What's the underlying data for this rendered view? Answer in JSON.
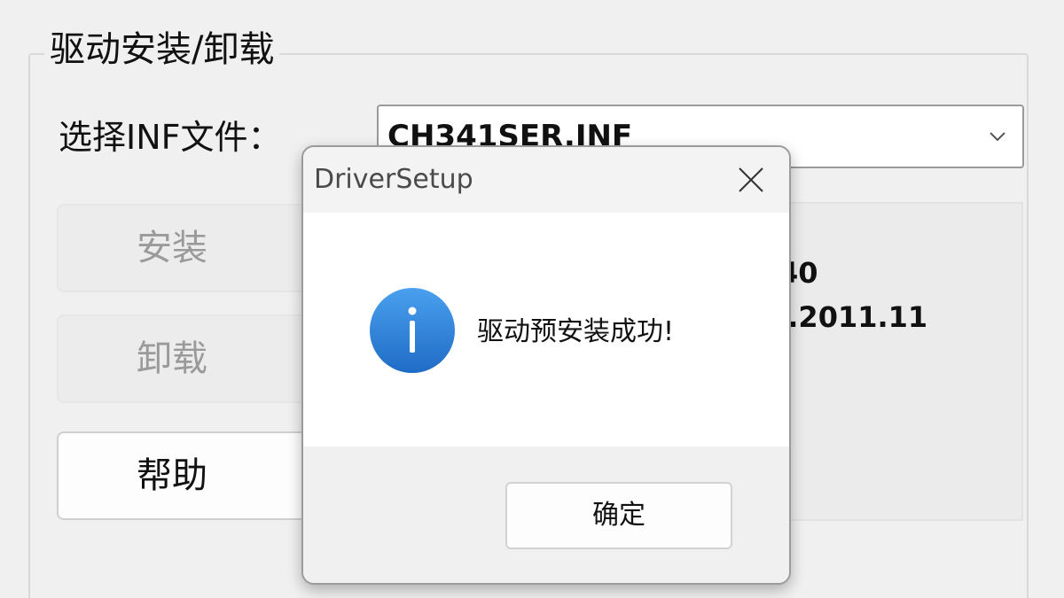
{
  "group": {
    "title": "驱动安装/卸载"
  },
  "inf": {
    "label": "选择INF文件：",
    "selected": "CH341SER.INF"
  },
  "buttons": {
    "install": "安装",
    "uninstall": "卸载",
    "help": "帮助"
  },
  "info_panel": {
    "line1": "40",
    "line2": "3.2011.11"
  },
  "dialog": {
    "title": "DriverSetup",
    "message": "驱动预安装成功!",
    "ok_label": "确定",
    "icon": "info-icon",
    "icon_color": "#2d7fd6"
  }
}
